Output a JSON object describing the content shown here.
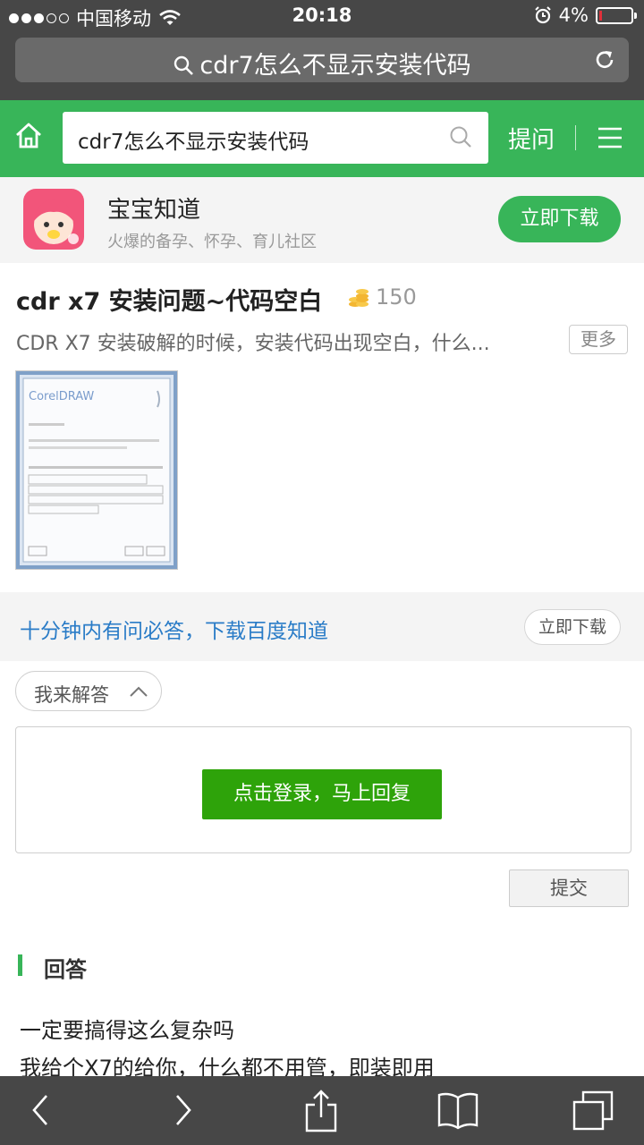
{
  "status": {
    "carrier": "中国移动",
    "time": "20:18",
    "battery": "4%"
  },
  "browser": {
    "url_text": "cdr7怎么不显示安装代码"
  },
  "header": {
    "search_value": "cdr7怎么不显示安装代码",
    "ask_label": "提问"
  },
  "app_banner": {
    "name": "宝宝知道",
    "description": "火爆的备孕、怀孕、育儿社区",
    "download_label": "立即下载"
  },
  "question": {
    "title": "cdr x7 安装问题~代码空白",
    "reward": "150",
    "description": "CDR X7 安装破解的时候，安装代码出现空白，什么...",
    "more_label": "更多",
    "image_window_title": "CorelDRAW"
  },
  "promo": {
    "text": "十分钟内有问必答，下载百度知道",
    "button_label": "立即下载"
  },
  "answer_form": {
    "toggle_label": "我来解答",
    "login_label": "点击登录，马上回复",
    "submit_label": "提交"
  },
  "answers": {
    "heading": "回答",
    "lines": [
      "一定要搞得这么复杂吗",
      "我给个X7的给你，什么都不用管，即装即用"
    ]
  },
  "colors": {
    "baidu_green": "#38b559",
    "login_green": "#2ea30a",
    "link_blue": "#2a7cc7",
    "safari_gray": "#474747"
  }
}
